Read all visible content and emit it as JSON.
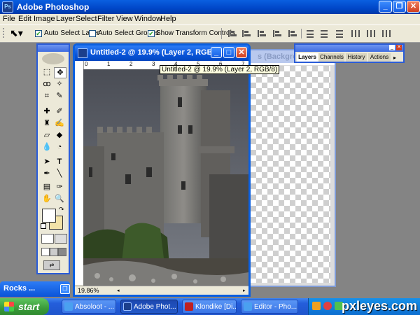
{
  "app": {
    "title": "Adobe Photoshop"
  },
  "menu": [
    "File",
    "Edit",
    "Image",
    "Layer",
    "Select",
    "Filter",
    "View",
    "Window",
    "Help"
  ],
  "options": {
    "auto_select_layer": "Auto Select Layer",
    "auto_select_groups": "Auto Select Groups",
    "show_transform_controls": "Show Transform Controls"
  },
  "document": {
    "title": "Untitled-2 @ 19.9% (Layer 2, RGB/8)",
    "tooltip": "Untitled-2 @ 19.9% (Layer 2, RGB/8)",
    "zoom": "19.86%",
    "ruler_marks": [
      "0",
      "1",
      "2",
      "3",
      "4",
      "5",
      "6",
      "7"
    ]
  },
  "back_document": {
    "title": "s (Backgrou"
  },
  "layers_palette": {
    "tabs": [
      "Layers",
      "Channels",
      "History",
      "Actions"
    ]
  },
  "minimized_window": {
    "title": "Rocks ..."
  },
  "taskbar": {
    "start": "start",
    "items": [
      "Absoloot - ...",
      "Adobe Phot...",
      "Klondike [Di...",
      "Editor - Pho..."
    ]
  },
  "watermark": "pxleyes.com",
  "colors": {
    "titlebar": "#0a5fe0",
    "taskbar": "#245edb",
    "start": "#3a9a3a",
    "chrome": "#ece9d8"
  }
}
